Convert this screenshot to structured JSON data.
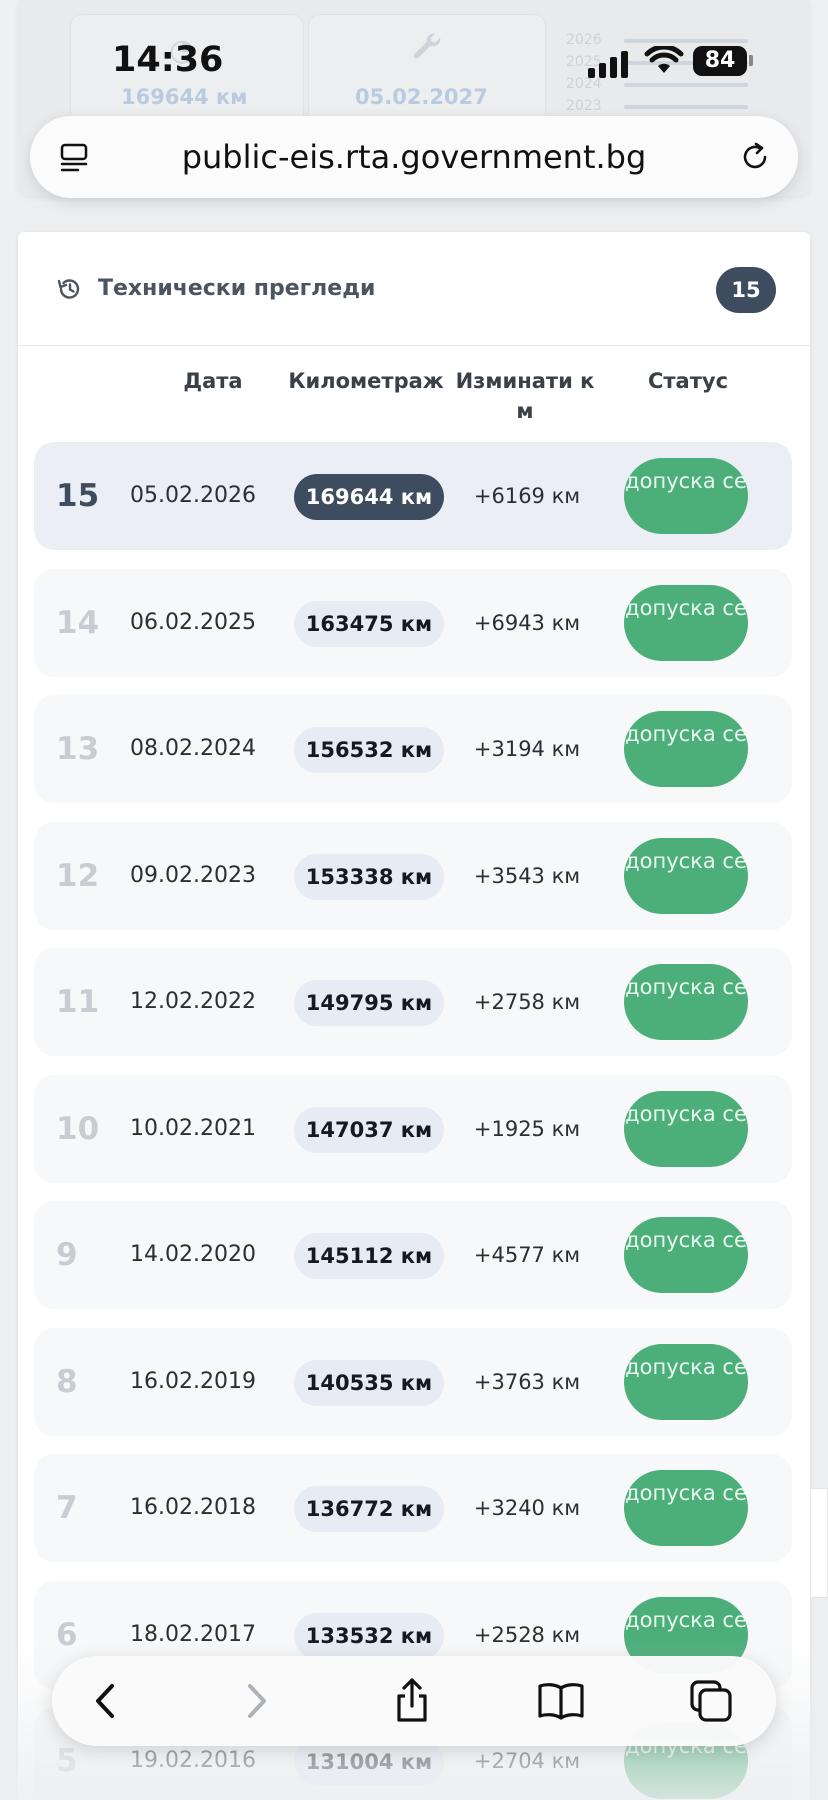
{
  "status_bar": {
    "time": "14:36",
    "battery": "84"
  },
  "background_cards": {
    "mileage": "169644 км",
    "next_inspection": "05.02.2027",
    "mini_chart_years": [
      "2026",
      "2025",
      "2024",
      "2023"
    ]
  },
  "browser": {
    "url": "public-eis.rta.government.bg"
  },
  "inspections": {
    "title": "Технически прегледи",
    "count": "15",
    "columns": {
      "date": "Дата",
      "mileage": "Километраж",
      "traveled": "Изминати к м",
      "status": "Статус"
    },
    "rows": [
      {
        "num": "15",
        "date": "05.02.2026",
        "km": "169644 км",
        "diff": "+6169 км",
        "status": "допуска се",
        "active": true
      },
      {
        "num": "14",
        "date": "06.02.2025",
        "km": "163475 км",
        "diff": "+6943 км",
        "status": "допуска се"
      },
      {
        "num": "13",
        "date": "08.02.2024",
        "km": "156532 км",
        "diff": "+3194 км",
        "status": "допуска се"
      },
      {
        "num": "12",
        "date": "09.02.2023",
        "km": "153338 км",
        "diff": "+3543 км",
        "status": "допуска се"
      },
      {
        "num": "11",
        "date": "12.02.2022",
        "km": "149795 км",
        "diff": "+2758 км",
        "status": "допуска се"
      },
      {
        "num": "10",
        "date": "10.02.2021",
        "km": "147037 км",
        "diff": "+1925 км",
        "status": "допуска се"
      },
      {
        "num": "9",
        "date": "14.02.2020",
        "km": "145112 км",
        "diff": "+4577 км",
        "status": "допуска се"
      },
      {
        "num": "8",
        "date": "16.02.2019",
        "km": "140535 км",
        "diff": "+3763 км",
        "status": "допуска се"
      },
      {
        "num": "7",
        "date": "16.02.2018",
        "km": "136772 км",
        "diff": "+3240 км",
        "status": "допуска се"
      },
      {
        "num": "6",
        "date": "18.02.2017",
        "km": "133532 км",
        "diff": "+2528 км",
        "status": "допуска се"
      },
      {
        "num": "5",
        "date": "19.02.2016",
        "km": "131004 км",
        "diff": "+2704 км",
        "status": "допуска се"
      }
    ]
  },
  "colors": {
    "accent_dark": "#3d4d5f",
    "status_green": "#4caf7a"
  },
  "toolbar_icons": [
    "back-icon",
    "forward-icon",
    "share-icon",
    "bookmarks-icon",
    "tabs-icon"
  ]
}
